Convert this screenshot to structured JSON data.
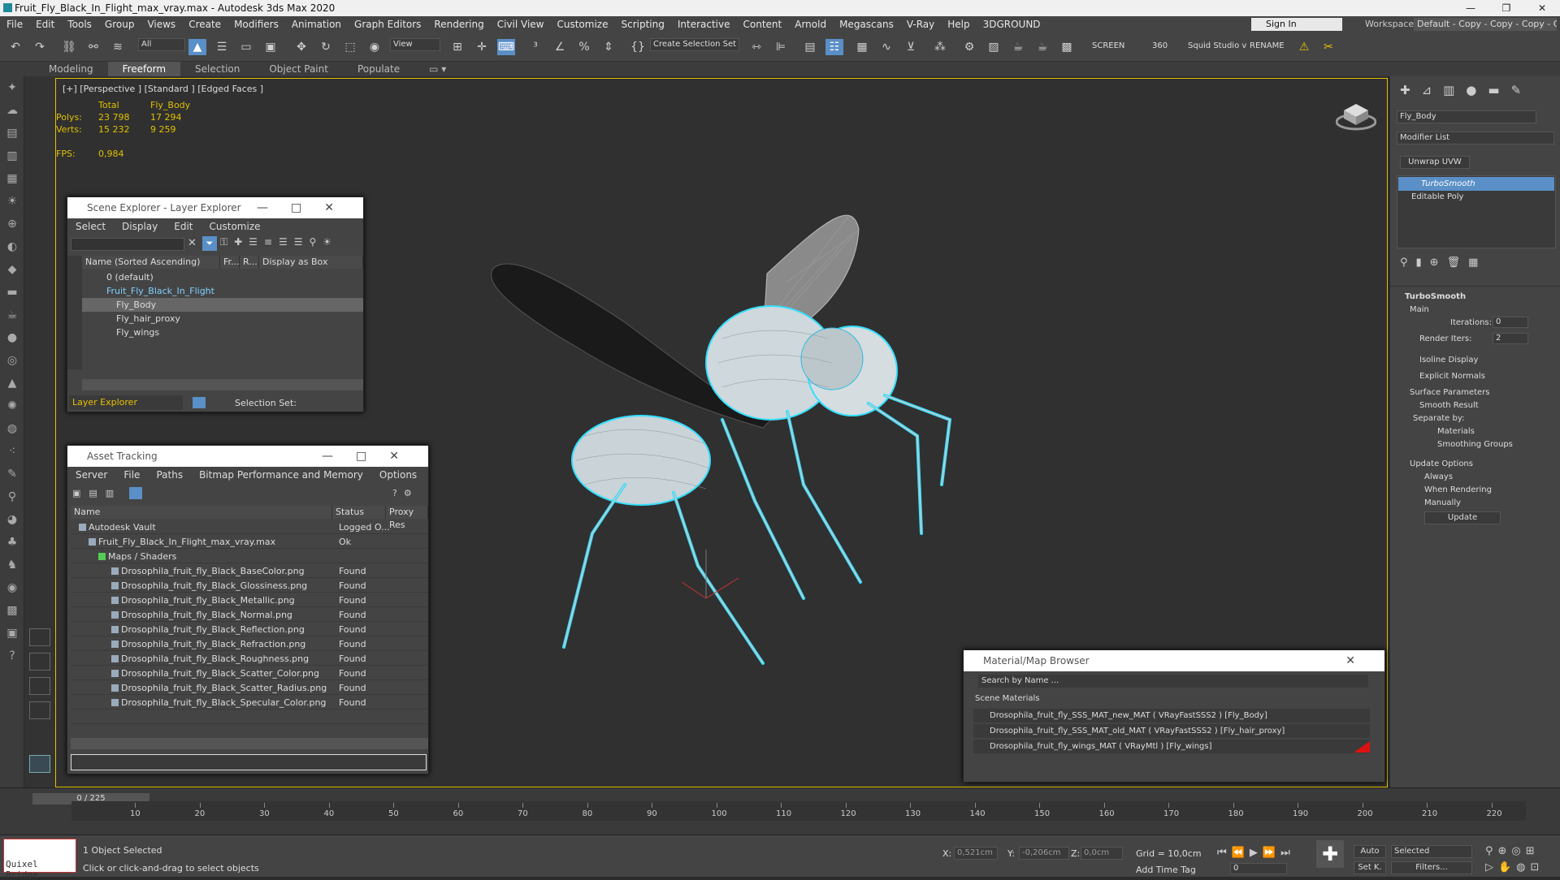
{
  "window": {
    "title": "Fruit_Fly_Black_In_Flight_max_vray.max - Autodesk 3ds Max 2020",
    "min": "—",
    "max": "❐",
    "close": "✕"
  },
  "menu": [
    "File",
    "Edit",
    "Tools",
    "Group",
    "Views",
    "Create",
    "Modifiers",
    "Animation",
    "Graph Editors",
    "Rendering",
    "Civil View",
    "Customize",
    "Scripting",
    "Interactive",
    "Content",
    "Arnold",
    "Megascans",
    "V-Ray",
    "Help",
    "3DGROUND"
  ],
  "signin": "Sign In",
  "workspaces": {
    "label": "Workspaces:",
    "value": "Default - Copy - Copy - Copy - Copy"
  },
  "toolbar": {
    "filter": "All",
    "view": "View",
    "selset": "Create Selection Set",
    "screen": "SCREEN",
    "angle": "360",
    "squid": "Squid Studio v",
    "rename": "RENAME"
  },
  "ribbon": [
    "Modeling",
    "Freeform",
    "Selection",
    "Object Paint",
    "Populate"
  ],
  "viewport": {
    "label": "[+] [Perspective ] [Standard ] [Edged Faces ]",
    "stats": {
      "total": "Total",
      "obj": "Fly_Body",
      "polys_l": "Polys:",
      "polys_t": "23 798",
      "polys_o": "17 294",
      "verts_l": "Verts:",
      "verts_t": "15 232",
      "verts_o": "9 259",
      "fps_l": "FPS:",
      "fps_v": "0,984"
    }
  },
  "scene_explorer": {
    "title": "Scene Explorer - Layer Explorer",
    "menu": [
      "Select",
      "Display",
      "Edit",
      "Customize"
    ],
    "cols": [
      "Name (Sorted Ascending)",
      "Fr...",
      "R...",
      "Display as Box"
    ],
    "rows": [
      "0 (default)",
      "Fruit_Fly_Black_In_Flight",
      "Fly_Body",
      "Fly_hair_proxy",
      "Fly_wings"
    ],
    "footer": "Layer Explorer",
    "selset": "Selection Set:"
  },
  "asset_tracking": {
    "title": "Asset Tracking",
    "menu": [
      "Server",
      "File",
      "Paths",
      "Bitmap Performance and Memory",
      "Options"
    ],
    "cols": [
      "Name",
      "Status",
      "Proxy Res"
    ],
    "rows": [
      {
        "name": "Autodesk Vault",
        "status": "Logged O..."
      },
      {
        "name": "Fruit_Fly_Black_In_Flight_max_vray.max",
        "status": "Ok"
      },
      {
        "name": "Maps / Shaders",
        "status": ""
      },
      {
        "name": "Drosophila_fruit_fly_Black_BaseColor.png",
        "status": "Found"
      },
      {
        "name": "Drosophila_fruit_fly_Black_Glossiness.png",
        "status": "Found"
      },
      {
        "name": "Drosophila_fruit_fly_Black_Metallic.png",
        "status": "Found"
      },
      {
        "name": "Drosophila_fruit_fly_Black_Normal.png",
        "status": "Found"
      },
      {
        "name": "Drosophila_fruit_fly_Black_Reflection.png",
        "status": "Found"
      },
      {
        "name": "Drosophila_fruit_fly_Black_Refraction.png",
        "status": "Found"
      },
      {
        "name": "Drosophila_fruit_fly_Black_Roughness.png",
        "status": "Found"
      },
      {
        "name": "Drosophila_fruit_fly_Black_Scatter_Color.png",
        "status": "Found"
      },
      {
        "name": "Drosophila_fruit_fly_Black_Scatter_Radius.png",
        "status": "Found"
      },
      {
        "name": "Drosophila_fruit_fly_Black_Specular_Color.png",
        "status": "Found"
      }
    ]
  },
  "material_browser": {
    "title": "Material/Map Browser",
    "search": "Search by Name ...",
    "group": "Scene Materials",
    "rows": [
      "Drosophila_fruit_fly_SSS_MAT_new_MAT  ( VRayFastSSS2 )  [Fly_Body]",
      "Drosophila_fruit_fly_SSS_MAT_old_MAT  ( VRayFastSSS2 )  [Fly_hair_proxy]",
      "Drosophila_fruit_fly_wings_MAT  ( VRayMtl )  [Fly_wings]"
    ]
  },
  "command_panel": {
    "object": "Fly_Body",
    "modlist": "Modifier List",
    "unwrap": "Unwrap UVW",
    "stack": [
      "TurboSmooth",
      "Editable Poly"
    ],
    "turbo": {
      "title": "TurboSmooth",
      "main": "Main",
      "iter_l": "Iterations:",
      "iter_v": "0",
      "render_l": "Render Iters:",
      "render_v": "2",
      "isoline": "Isoline Display",
      "explicit": "Explicit Normals",
      "surface": "Surface Parameters",
      "smooth": "Smooth Result",
      "sepby": "Separate by:",
      "materials": "Materials",
      "sgroups": "Smoothing Groups",
      "update_opts": "Update Options",
      "always": "Always",
      "whenrend": "When Rendering",
      "manually": "Manually",
      "update": "Update"
    }
  },
  "timeline": {
    "frame": "0 / 225",
    "ticks": [
      "10",
      "20",
      "30",
      "40",
      "50",
      "60",
      "70",
      "80",
      "90",
      "100",
      "110",
      "120",
      "130",
      "140",
      "150",
      "160",
      "170",
      "180",
      "190",
      "200",
      "210",
      "220"
    ]
  },
  "status": {
    "quixel": "Quixel Bridge",
    "selected": "1 Object Selected",
    "hint": "Click or click-and-drag to select objects",
    "x_l": "X:",
    "x_v": "0,521cm",
    "y_l": "Y:",
    "y_v": "-0,206cm",
    "z_l": "Z:",
    "z_v": "0,0cm",
    "grid": "Grid = 10,0cm",
    "addtag": "Add Time Tag",
    "auto": "Auto",
    "selected_dd": "Selected",
    "setk": "Set K.",
    "filters": "Filters...",
    "frame_v": "0"
  }
}
